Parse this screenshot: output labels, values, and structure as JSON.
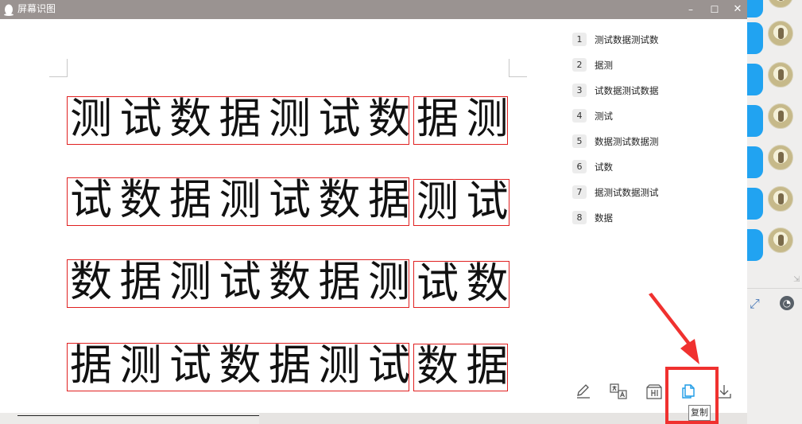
{
  "window": {
    "title": "屏幕识图",
    "controls": {
      "minimize": "–",
      "maximize": "☐",
      "close": "✕"
    }
  },
  "image_lines": [
    {
      "left_text": "测试数据测试数",
      "right_text": "据测"
    },
    {
      "left_text": "试数据测试数据",
      "right_text": "测试"
    },
    {
      "left_text": "数据测试数据测",
      "right_text": "试数"
    },
    {
      "left_text": "据测试数据测试",
      "right_text": "数据"
    }
  ],
  "results": [
    {
      "num": "1",
      "text": "测试数据测试数"
    },
    {
      "num": "2",
      "text": "据测"
    },
    {
      "num": "3",
      "text": "试数据测试数据"
    },
    {
      "num": "4",
      "text": "测试"
    },
    {
      "num": "5",
      "text": "数据测试数据测"
    },
    {
      "num": "6",
      "text": "试数"
    },
    {
      "num": "7",
      "text": "据测试数据测试"
    },
    {
      "num": "8",
      "text": "数据"
    }
  ],
  "toolbar": {
    "tools": [
      "edit-icon",
      "translate-icon",
      "export-icon",
      "copy-icon",
      "download-icon"
    ],
    "copy_tooltip": "复制"
  },
  "colors": {
    "accent": "#1d9be6",
    "ocr_box": "#e02020",
    "annotation": "#f0312f",
    "titlebar": "#9a9391"
  }
}
